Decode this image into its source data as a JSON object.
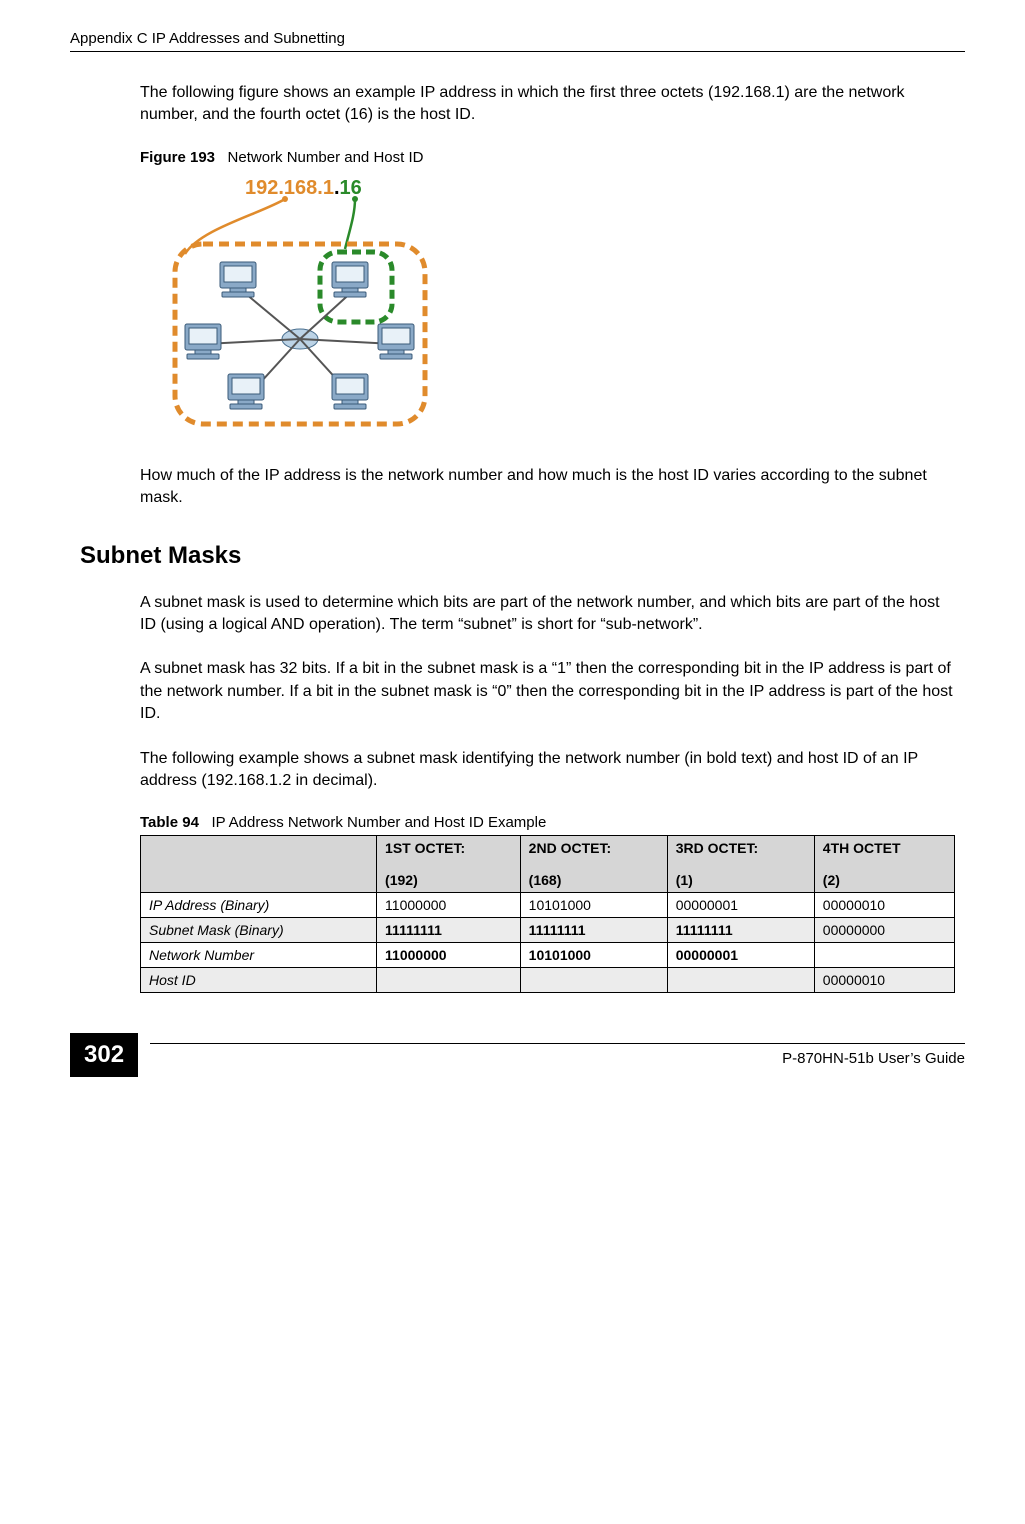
{
  "header": {
    "left": "Appendix C IP Addresses and Subnetting"
  },
  "intro_para": "The following figure shows an example IP address in which the first three octets (192.168.1) are the network number, and the fourth octet (16) is the host ID.",
  "figure": {
    "label": "Figure 193",
    "title": "Network Number and Host ID",
    "ip_text": "192.168.1.16"
  },
  "after_figure": "How much of the IP address is the network number and how much is the host ID varies according to the subnet mask.",
  "section_title": "Subnet Masks",
  "section_p1": "A subnet mask is used to determine which bits are part of the network number, and which bits are part of the host ID (using a logical AND operation). The term “subnet” is short for “sub-network”.",
  "section_p2": "A subnet mask has 32 bits. If a bit in the subnet mask is a “1” then the corresponding bit in the IP address is part of the network number. If a bit in the subnet mask is “0” then the corresponding bit in the IP address is part of the host ID.",
  "section_p3": "The following example shows a subnet mask identifying the network number (in bold text) and host ID of an IP address (192.168.1.2 in decimal).",
  "table": {
    "label": "Table 94",
    "title": "IP Address Network Number and Host ID Example",
    "headers": {
      "c1": "",
      "c2a": "1ST OCTET:",
      "c2b": "(192)",
      "c3a": "2ND OCTET:",
      "c3b": "(168)",
      "c4a": "3RD OCTET:",
      "c4b": "(1)",
      "c5a": "4TH OCTET",
      "c5b": "(2)"
    },
    "rows": [
      {
        "label": "IP Address (Binary)",
        "c2": "11000000",
        "c3": "10101000",
        "c4": "00000001",
        "c5": "00000010",
        "bold": []
      },
      {
        "label": "Subnet Mask (Binary)",
        "c2": "11111111",
        "c3": "11111111",
        "c4": "11111111",
        "c5": "00000000",
        "bold": [
          "c2",
          "c3",
          "c4"
        ]
      },
      {
        "label": "Network Number",
        "c2": "11000000",
        "c3": "10101000",
        "c4": "00000001",
        "c5": "",
        "bold": [
          "c2",
          "c3",
          "c4"
        ]
      },
      {
        "label": "Host ID",
        "c2": "",
        "c3": "",
        "c4": "",
        "c5": "00000010",
        "bold": []
      }
    ]
  },
  "footer": {
    "page": "302",
    "right": "P-870HN-51b User’s Guide"
  }
}
